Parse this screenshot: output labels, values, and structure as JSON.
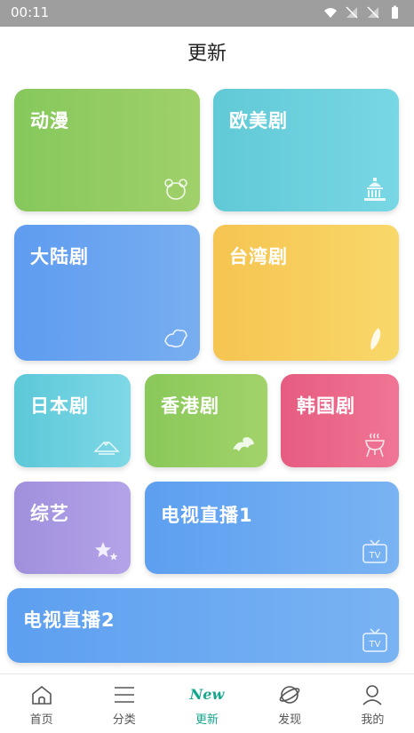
{
  "status_bar": {
    "time": "00:11"
  },
  "header": {
    "title": "更新"
  },
  "categories": [
    {
      "label": "动漫",
      "icon": "bear-icon",
      "color": "#94cc62"
    },
    {
      "label": "欧美剧",
      "icon": "capitol-icon",
      "color": "#6ad0dd"
    },
    {
      "label": "大陆剧",
      "icon": "china-map-icon",
      "color": "#68a4f0"
    },
    {
      "label": "台湾剧",
      "icon": "taiwan-map-icon",
      "color": "#f7cf5d"
    },
    {
      "label": "日本剧",
      "icon": "mount-fuji-icon",
      "color": "#6cd0df"
    },
    {
      "label": "香港剧",
      "icon": "bauhinia-icon",
      "color": "#95cd62"
    },
    {
      "label": "韩国剧",
      "icon": "barbecue-grill-icon",
      "color": "#ea6888"
    },
    {
      "label": "综艺",
      "icon": "stars-icon",
      "color": "#a999e2"
    },
    {
      "label": "电视直播1",
      "icon": "tv-icon",
      "color": "#6aa9f2"
    },
    {
      "label": "电视直播2",
      "icon": "tv-icon",
      "color": "#6aa9f2"
    }
  ],
  "tv_icon_text": "TV",
  "tabs": [
    {
      "label": "首页",
      "icon": "home-icon",
      "active": false
    },
    {
      "label": "分类",
      "icon": "list-icon",
      "active": false
    },
    {
      "label": "更新",
      "icon": "new-badge-icon",
      "badge_text": "New",
      "active": true
    },
    {
      "label": "发现",
      "icon": "planet-icon",
      "active": false
    },
    {
      "label": "我的",
      "icon": "user-icon",
      "active": false
    }
  ],
  "accent_color": "#17a68e"
}
